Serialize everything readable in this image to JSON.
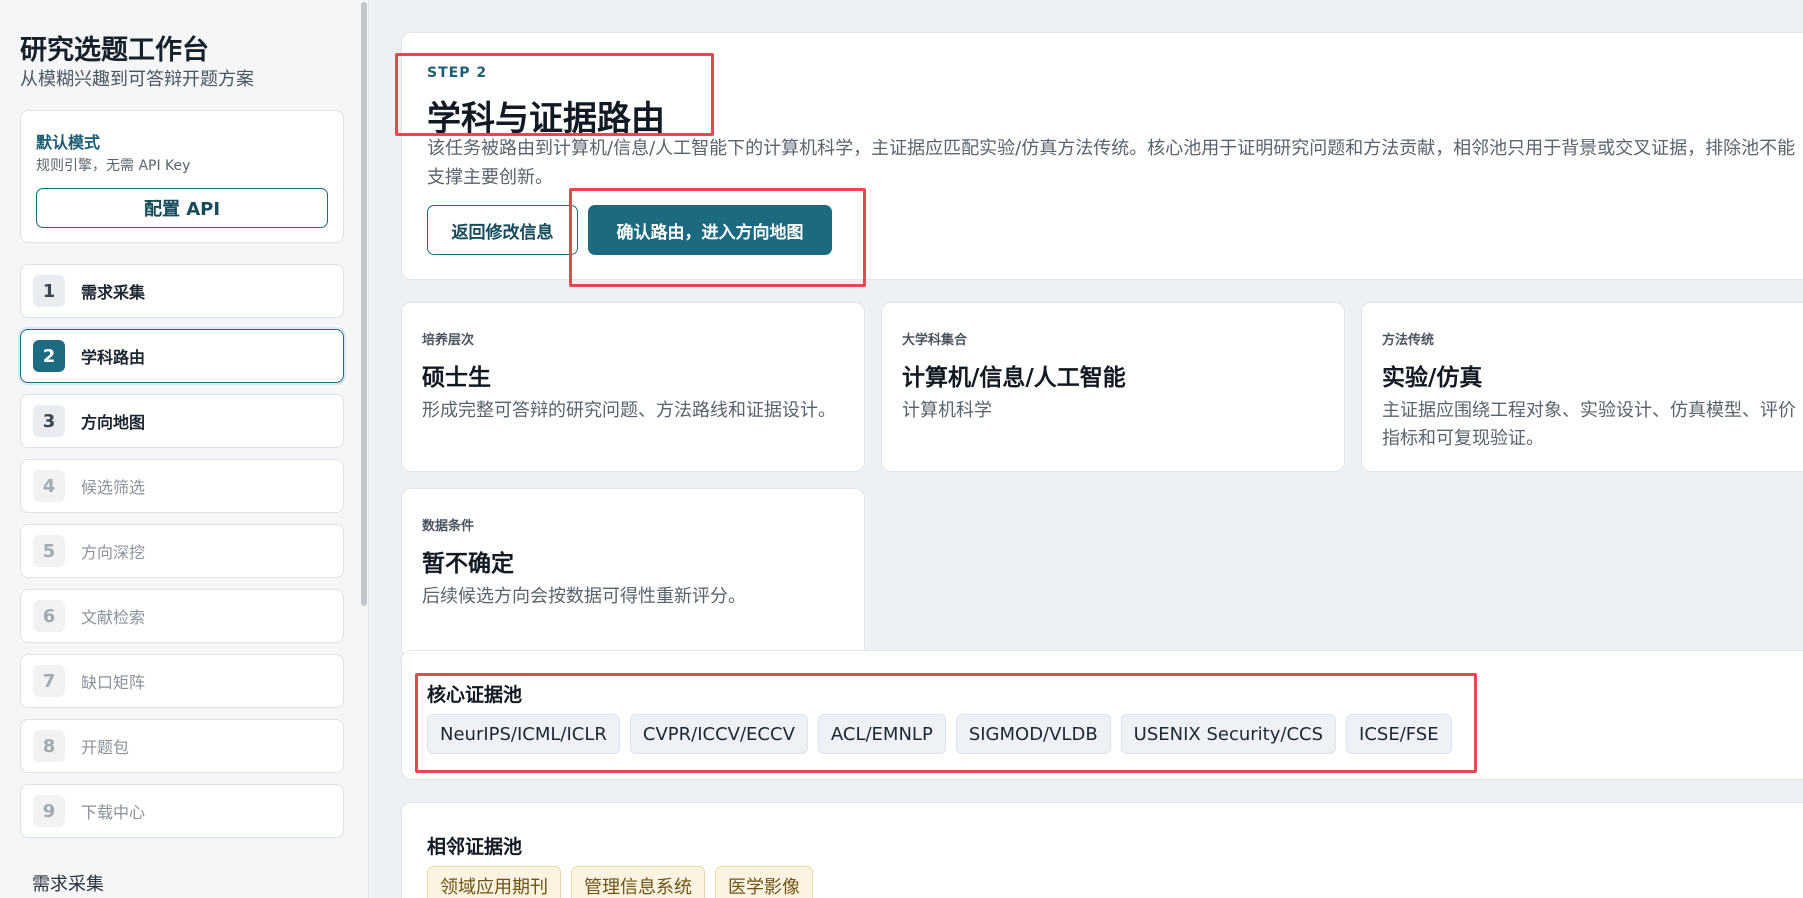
{
  "sidebar": {
    "title": "研究选题工作台",
    "subtitle": "从模糊兴趣到可答辩开题方案",
    "mode": {
      "title": "默认模式",
      "desc": "规则引擎，无需 API Key",
      "config_label": "配置 API"
    },
    "steps": [
      {
        "num": "1",
        "label": "需求采集",
        "state": "done"
      },
      {
        "num": "2",
        "label": "学科路由",
        "state": "active"
      },
      {
        "num": "3",
        "label": "方向地图",
        "state": "available"
      },
      {
        "num": "4",
        "label": "候选筛选",
        "state": "disabled"
      },
      {
        "num": "5",
        "label": "方向深挖",
        "state": "disabled"
      },
      {
        "num": "6",
        "label": "文献检索",
        "state": "disabled"
      },
      {
        "num": "7",
        "label": "缺口矩阵",
        "state": "disabled"
      },
      {
        "num": "8",
        "label": "开题包",
        "state": "disabled"
      },
      {
        "num": "9",
        "label": "下载中心",
        "state": "disabled"
      }
    ],
    "footer": "需求采集"
  },
  "main": {
    "step_tag": "STEP 2",
    "title": "学科与证据路由",
    "description": "该任务被路由到计算机/信息/人工智能下的计算机科学，主证据应匹配实验/仿真方法传统。核心池用于证明研究问题和方法贡献，相邻池只用于背景或交叉证据，排除池不能支撑主要创新。",
    "back_label": "返回修改信息",
    "confirm_label": "确认路由，进入方向地图",
    "info_cards": [
      {
        "label": "培养层次",
        "value": "硕士生",
        "desc": "形成完整可答辩的研究问题、方法路线和证据设计。"
      },
      {
        "label": "大学科集合",
        "value": "计算机/信息/人工智能",
        "desc": "计算机科学"
      },
      {
        "label": "方法传统",
        "value": "实验/仿真",
        "desc": "主证据应围绕工程对象、实验设计、仿真模型、评价指标和可复现验证。"
      },
      {
        "label": "数据条件",
        "value": "暂不确定",
        "desc": "后续候选方向会按数据可得性重新评分。"
      }
    ],
    "core_pool": {
      "title": "核心证据池",
      "items": [
        "NeurIPS/ICML/ICLR",
        "CVPR/ICCV/ECCV",
        "ACL/EMNLP",
        "SIGMOD/VLDB",
        "USENIX Security/CCS",
        "ICSE/FSE"
      ]
    },
    "adjacent_pool": {
      "title": "相邻证据池",
      "items": [
        "领域应用期刊",
        "管理信息系统",
        "医学影像"
      ]
    }
  },
  "colors": {
    "accent": "#1b6a80",
    "highlight": "#e5484f",
    "warm_chip": "#fcf4e1"
  }
}
